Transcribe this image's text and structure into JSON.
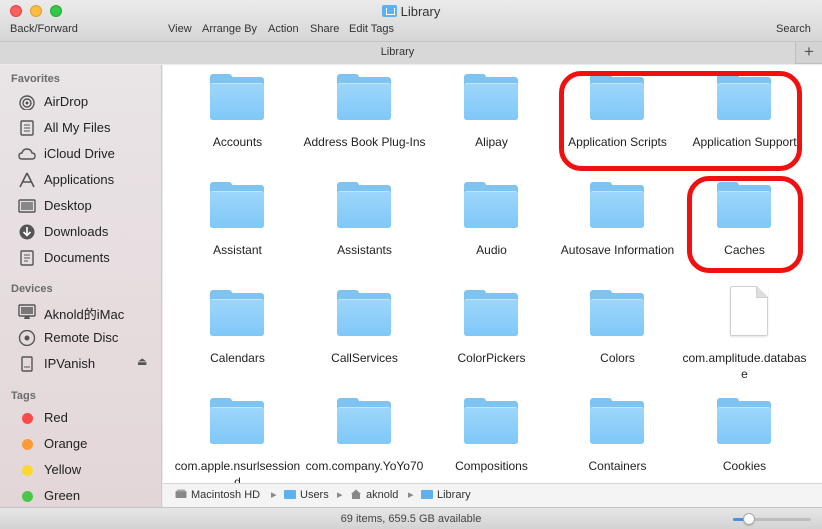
{
  "window": {
    "title": "Library",
    "icon": "library-folder-icon"
  },
  "toolbar": {
    "back_forward": "Back/Forward",
    "view": "View",
    "arrange_by": "Arrange By",
    "action": "Action",
    "share": "Share",
    "edit_tags": "Edit Tags",
    "search": "Search"
  },
  "tabbar": {
    "tab_label": "Library",
    "add_label": "+"
  },
  "sidebar": {
    "favorites_heading": "Favorites",
    "favorites": [
      {
        "label": "AirDrop",
        "icon": "airdrop-icon"
      },
      {
        "label": "All My Files",
        "icon": "all-files-icon"
      },
      {
        "label": "iCloud Drive",
        "icon": "cloud-icon"
      },
      {
        "label": "Applications",
        "icon": "applications-icon"
      },
      {
        "label": "Desktop",
        "icon": "desktop-icon"
      },
      {
        "label": "Downloads",
        "icon": "downloads-icon"
      },
      {
        "label": "Documents",
        "icon": "documents-icon"
      }
    ],
    "devices_heading": "Devices",
    "devices": [
      {
        "label": "Aknold的iMac",
        "icon": "imac-icon"
      },
      {
        "label": "Remote Disc",
        "icon": "disc-icon"
      },
      {
        "label": "IPVanish",
        "icon": "drive-icon",
        "eject": "⏏"
      }
    ],
    "tags_heading": "Tags",
    "tags": [
      {
        "label": "Red",
        "color": "#fc4a4a"
      },
      {
        "label": "Orange",
        "color": "#fd9a35"
      },
      {
        "label": "Yellow",
        "color": "#fbd830"
      },
      {
        "label": "Green",
        "color": "#4cc64a"
      }
    ]
  },
  "items": [
    {
      "name": "Accounts",
      "kind": "folder"
    },
    {
      "name": "Address Book Plug-Ins",
      "kind": "folder"
    },
    {
      "name": "Alipay",
      "kind": "folder"
    },
    {
      "name": "Application Scripts",
      "kind": "folder"
    },
    {
      "name": "Application Support",
      "kind": "folder"
    },
    {
      "name": "Assistant",
      "kind": "folder"
    },
    {
      "name": "Assistants",
      "kind": "folder"
    },
    {
      "name": "Audio",
      "kind": "folder"
    },
    {
      "name": "Autosave Information",
      "kind": "folder"
    },
    {
      "name": "Caches",
      "kind": "folder"
    },
    {
      "name": "Calendars",
      "kind": "folder"
    },
    {
      "name": "CallServices",
      "kind": "folder"
    },
    {
      "name": "ColorPickers",
      "kind": "folder"
    },
    {
      "name": "Colors",
      "kind": "folder"
    },
    {
      "name": "com.amplitude.database",
      "kind": "file"
    },
    {
      "name": "com.apple.nsurlsessiond",
      "kind": "folder"
    },
    {
      "name": "com.company.YoYo70",
      "kind": "folder"
    },
    {
      "name": "Compositions",
      "kind": "folder"
    },
    {
      "name": "Containers",
      "kind": "folder"
    },
    {
      "name": "Cookies",
      "kind": "folder"
    }
  ],
  "pathbar": [
    {
      "label": "Macintosh HD",
      "icon": "hard-drive-icon"
    },
    {
      "label": "Users",
      "icon": "folder-icon"
    },
    {
      "label": "aknold",
      "icon": "home-icon"
    },
    {
      "label": "Library",
      "icon": "folder-icon"
    }
  ],
  "status": {
    "text": "69 items, 659.5 GB available",
    "icon_size_fraction": 0.2
  },
  "colors": {
    "folder": "#7fc4f1",
    "highlight": "#f01010",
    "accent": "#4a90e2"
  }
}
